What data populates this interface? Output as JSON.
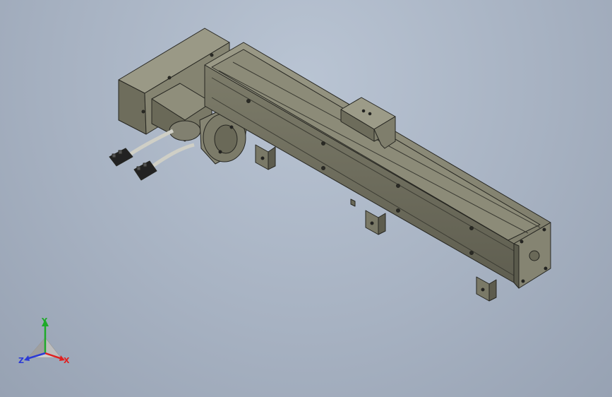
{
  "viewport": {
    "background": "#a9b4c4"
  },
  "colors": {
    "body": "#7f7e6d",
    "body_dark": "#5e5d4f",
    "body_light": "#a3a290",
    "edge": "#262621",
    "connector": "#1d1d1d",
    "cable": "#c8c8c0",
    "axis_x": "#e02020",
    "axis_y": "#1faa2a",
    "axis_z": "#2b3ad6"
  },
  "triad": {
    "x_label": "X",
    "y_label": "Y",
    "z_label": "Z"
  }
}
